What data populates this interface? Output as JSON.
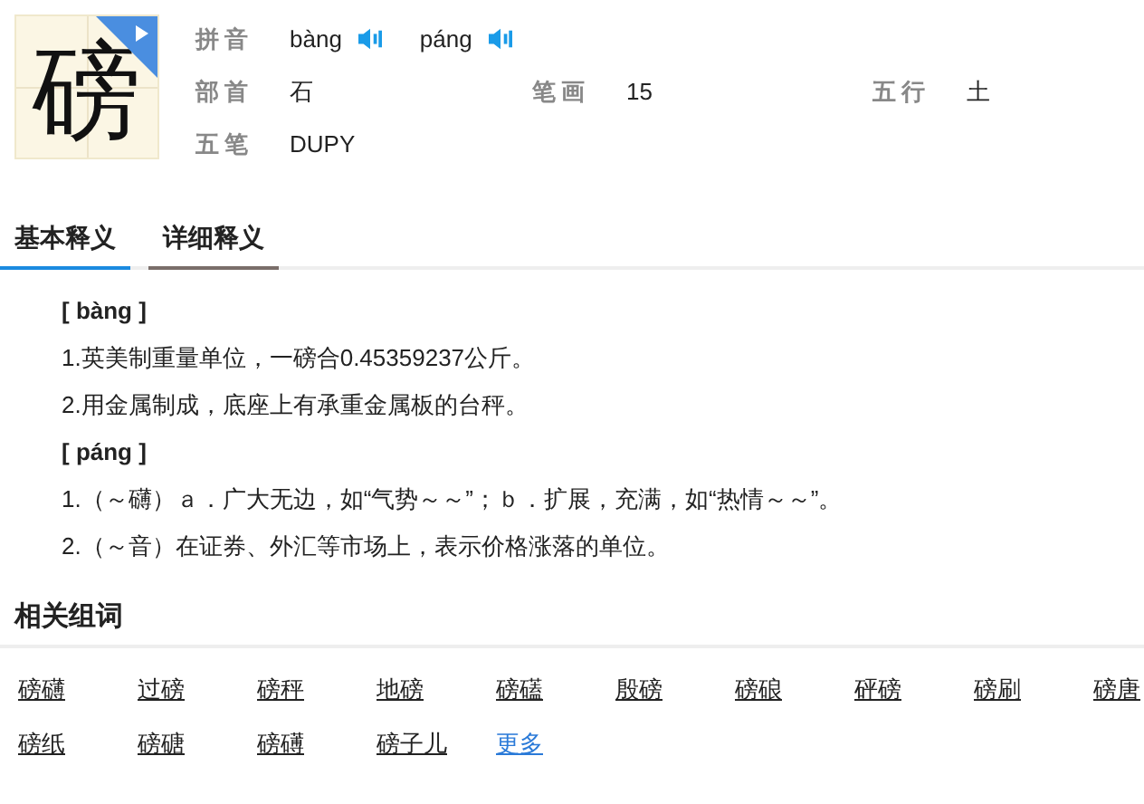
{
  "character": "磅",
  "pinyin": {
    "label": "拼音",
    "readings": [
      "bàng",
      "páng"
    ]
  },
  "info": [
    {
      "label": "部首",
      "value": "石"
    },
    {
      "label": "笔画",
      "value": "15"
    },
    {
      "label": "五行",
      "value": "土"
    }
  ],
  "wubi": {
    "label": "五笔",
    "value": "DUPY"
  },
  "tabs": [
    {
      "label": "基本释义",
      "selected": true
    },
    {
      "label": "详细释义",
      "selected": false
    }
  ],
  "definitions": [
    {
      "pinyin": "[ bàng ]",
      "items": [
        "1.英美制重量单位，一磅合0.45359237公斤。",
        "2.用金属制成，底座上有承重金属板的台秤。"
      ]
    },
    {
      "pinyin": "[ páng ]",
      "items": [
        "1.（～礴）ａ．广大无边，如“气势～～”；ｂ．扩展，充满，如“热情～～”。",
        "2.（～音）在证券、外汇等市场上，表示价格涨落的单位。"
      ]
    }
  ],
  "related": {
    "title": "相关组词",
    "words": [
      {
        "text": "磅礴",
        "kind": "word"
      },
      {
        "text": "过磅",
        "kind": "word"
      },
      {
        "text": "磅秤",
        "kind": "word"
      },
      {
        "text": "地磅",
        "kind": "word"
      },
      {
        "text": "磅礚",
        "kind": "word"
      },
      {
        "text": "殷磅",
        "kind": "word"
      },
      {
        "text": "磅硠",
        "kind": "word"
      },
      {
        "text": "砰磅",
        "kind": "word"
      },
      {
        "text": "磅刷",
        "kind": "word"
      },
      {
        "text": "磅唐",
        "kind": "word"
      },
      {
        "text": "磅纸",
        "kind": "word"
      },
      {
        "text": "磅磄",
        "kind": "word"
      },
      {
        "text": "磅礡",
        "kind": "word"
      },
      {
        "text": "磅子儿",
        "kind": "word"
      },
      {
        "text": "更多",
        "kind": "more"
      }
    ]
  }
}
